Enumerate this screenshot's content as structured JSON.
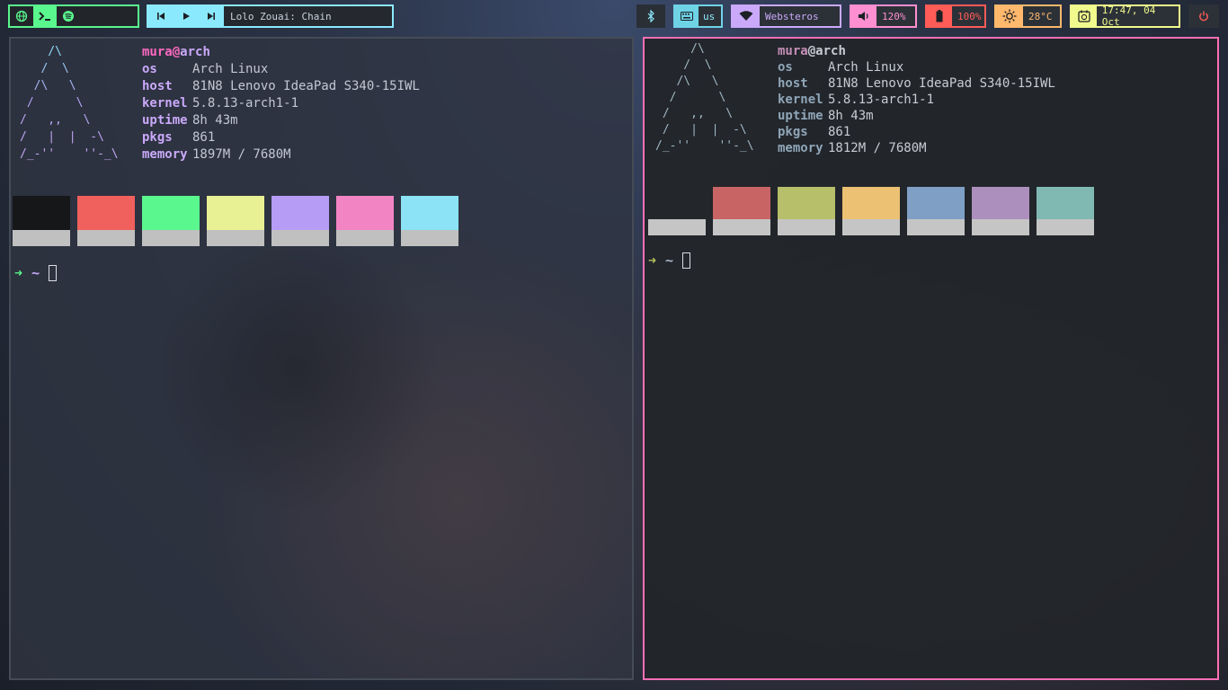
{
  "topbar": {
    "launcher": {
      "icons": [
        "globe-icon",
        "terminal-icon",
        "spotify-icon"
      ]
    },
    "media": {
      "icons": [
        "previous-icon",
        "play-icon",
        "next-icon"
      ],
      "title": "Lolo Zouai: Chain"
    },
    "bluetooth": {
      "icon": "bluetooth-icon"
    },
    "keyboard": {
      "icon": "keyboard-icon",
      "value": "us"
    },
    "wifi": {
      "icon": "wifi-icon",
      "value": "Websteros"
    },
    "volume": {
      "icon": "volume-icon",
      "value": "120%"
    },
    "battery": {
      "icon": "battery-icon",
      "value": "100%"
    },
    "temperature": {
      "icon": "sun-icon",
      "value": "28°C"
    },
    "clock": {
      "icon": "clock-icon",
      "value": "17:47, 04 Oct"
    },
    "power": {
      "icon": "power-icon"
    }
  },
  "colors": {
    "left_swatches": [
      "#151718",
      "#f0605c",
      "#5af78e",
      "#e8f193",
      "#b79cf5",
      "#f384c4",
      "#8be3f5"
    ],
    "right_swatches": [
      "transparent",
      "#c86464",
      "#b7bf6a",
      "#ecc173",
      "#7f9fc4",
      "#ad8fbd",
      "#7fb9b2"
    ]
  },
  "terminals": {
    "left": {
      "logo": "    /\\\n   /  \\\n  /\\   \\\n /      \\\n/   ,,   \\\n/   |  |  -\\\n/_-''    ''-_\\",
      "user": "mura",
      "at": "@",
      "host": "arch",
      "rows": [
        {
          "key": "os",
          "val": "Arch Linux"
        },
        {
          "key": "host",
          "val": "81N8 Lenovo IdeaPad S340-15IWL"
        },
        {
          "key": "kernel",
          "val": "5.8.13-arch1-1"
        },
        {
          "key": "uptime",
          "val": "8h 43m"
        },
        {
          "key": "pkgs",
          "val": "861"
        },
        {
          "key": "memory",
          "val": "1897M / 7680M"
        }
      ],
      "prompt_arrow": "➜",
      "prompt_dir": "~"
    },
    "right": {
      "logo": "     /\\\n    /  \\\n   /\\   \\\n  /      \\\n /   ,,   \\\n /   |  |  -\\\n/_-''    ''-_\\",
      "user": "mura",
      "at": "@",
      "host": "arch",
      "rows": [
        {
          "key": "os",
          "val": "Arch Linux"
        },
        {
          "key": "host",
          "val": "81N8 Lenovo IdeaPad S340-15IWL"
        },
        {
          "key": "kernel",
          "val": "5.8.13-arch1-1"
        },
        {
          "key": "uptime",
          "val": "8h 43m"
        },
        {
          "key": "pkgs",
          "val": "861"
        },
        {
          "key": "memory",
          "val": "1812M / 7680M"
        }
      ],
      "prompt_arrow": "➜",
      "prompt_dir": "~"
    }
  }
}
